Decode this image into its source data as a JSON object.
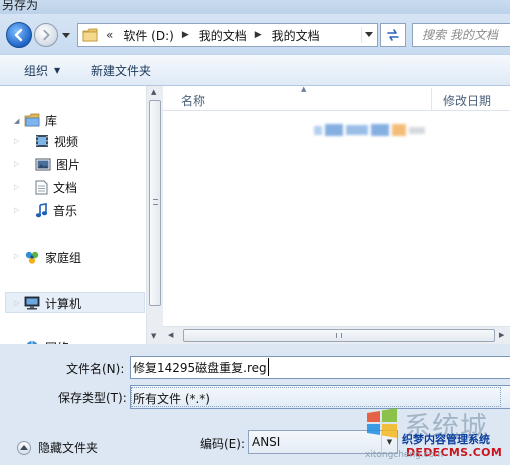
{
  "window": {
    "title": "另存为"
  },
  "navigation": {
    "address_chevrons": "«",
    "breadcrumb": [
      "软件 (D:)",
      "我的文档",
      "我的文档"
    ],
    "search_placeholder": "搜索 我的文档"
  },
  "toolbar": {
    "organize_label": "组织",
    "new_folder_label": "新建文件夹"
  },
  "nav_pane": {
    "items": [
      {
        "label": "库",
        "icon": "library-folder-icon"
      },
      {
        "label": "视频",
        "icon": "video-icon"
      },
      {
        "label": "图片",
        "icon": "picture-icon"
      },
      {
        "label": "文档",
        "icon": "document-icon"
      },
      {
        "label": "音乐",
        "icon": "music-note-icon"
      },
      {
        "label": "家庭组",
        "icon": "homegroup-icon"
      },
      {
        "label": "计算机",
        "icon": "computer-icon"
      },
      {
        "label": "网络",
        "icon": "network-icon"
      }
    ]
  },
  "file_list": {
    "columns": [
      "名称",
      "修改日期"
    ]
  },
  "form": {
    "filename_label": "文件名(N):",
    "filename_value": "修复14295磁盘重复.reg",
    "filetype_label": "保存类型(T):",
    "filetype_value": "所有文件  (*.*)",
    "encoding_label": "编码(E):",
    "encoding_value": "ANSI",
    "hide_folders_label": "隐藏文件夹"
  },
  "watermark": {
    "big_text": "系统城",
    "line1": "织梦内容管理系统",
    "line2": "DEDECMS.COM",
    "small": "xitongcheng.com"
  },
  "colors": {
    "frame": "#dce7f3",
    "accent_blue": "#1f63c6",
    "watermark_blue": "#0b3e9c",
    "watermark_red": "#c8161d"
  }
}
